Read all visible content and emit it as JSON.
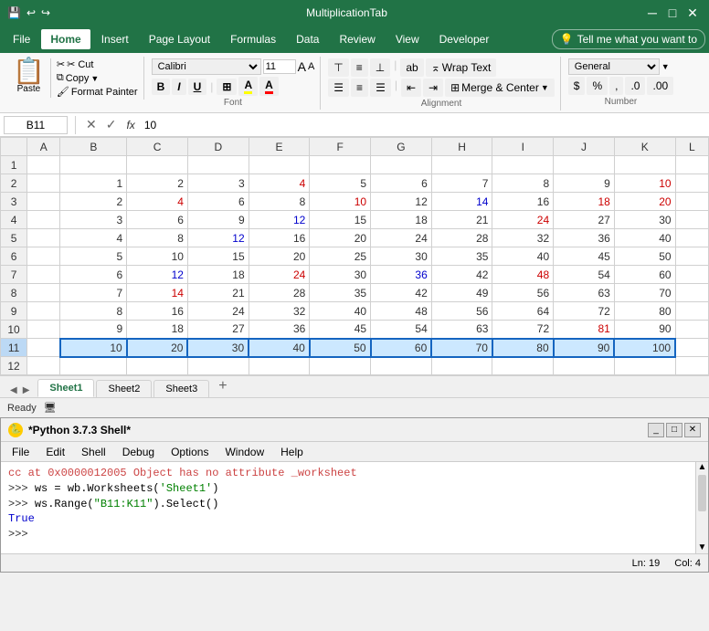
{
  "titleBar": {
    "title": "MultiplicationTab",
    "saveIcon": "💾",
    "undoIcon": "↩",
    "redoIcon": "↪"
  },
  "menuBar": {
    "items": [
      "File",
      "Home",
      "Insert",
      "Page Layout",
      "Formulas",
      "Data",
      "Review",
      "View",
      "Developer"
    ],
    "activeItem": "Home",
    "tellMe": "Tell me what you want to"
  },
  "ribbon": {
    "clipboard": {
      "paste": "Paste",
      "cut": "✂ Cut",
      "copy": "Copy",
      "formatPainter": "Format Painter"
    },
    "font": {
      "name": "Calibri",
      "size": "11",
      "bold": "B",
      "italic": "I",
      "underline": "U"
    },
    "alignment": {
      "wrapText": "Wrap Text",
      "mergeCenter": "Merge & Center"
    },
    "number": {
      "format": "General"
    }
  },
  "formulaBar": {
    "cellRef": "B11",
    "formula": "10"
  },
  "spreadsheet": {
    "colHeaders": [
      "",
      "A",
      "B",
      "C",
      "D",
      "E",
      "F",
      "G",
      "H",
      "I",
      "J",
      "K",
      "L"
    ],
    "rows": [
      {
        "id": 1,
        "cells": [
          "",
          "",
          "",
          "",
          "",
          "",
          "",
          "",
          "",
          "",
          "",
          ""
        ]
      },
      {
        "id": 2,
        "cells": [
          "",
          "1",
          "2",
          "3",
          "4",
          "5",
          "6",
          "7",
          "8",
          "9",
          "10"
        ]
      },
      {
        "id": 3,
        "cells": [
          "",
          "2",
          "4",
          "6",
          "8",
          "10",
          "12",
          "14",
          "16",
          "18",
          "20"
        ]
      },
      {
        "id": 4,
        "cells": [
          "",
          "3",
          "6",
          "9",
          "12",
          "15",
          "18",
          "21",
          "24",
          "27",
          "30"
        ]
      },
      {
        "id": 5,
        "cells": [
          "",
          "4",
          "8",
          "12",
          "16",
          "20",
          "24",
          "28",
          "32",
          "36",
          "40"
        ]
      },
      {
        "id": 6,
        "cells": [
          "",
          "5",
          "10",
          "15",
          "20",
          "25",
          "30",
          "35",
          "40",
          "45",
          "50"
        ]
      },
      {
        "id": 7,
        "cells": [
          "",
          "6",
          "12",
          "18",
          "24",
          "30",
          "36",
          "42",
          "48",
          "54",
          "60"
        ]
      },
      {
        "id": 8,
        "cells": [
          "",
          "7",
          "14",
          "21",
          "28",
          "35",
          "42",
          "49",
          "56",
          "63",
          "70"
        ]
      },
      {
        "id": 9,
        "cells": [
          "",
          "8",
          "16",
          "24",
          "32",
          "40",
          "48",
          "56",
          "64",
          "72",
          "80"
        ]
      },
      {
        "id": 10,
        "cells": [
          "",
          "9",
          "18",
          "27",
          "36",
          "45",
          "54",
          "63",
          "72",
          "81",
          "90"
        ]
      },
      {
        "id": 11,
        "cells": [
          "",
          "10",
          "20",
          "30",
          "40",
          "50",
          "60",
          "70",
          "80",
          "90",
          "100"
        ]
      }
    ],
    "selectedRange": "B11:K11"
  },
  "sheetTabs": {
    "sheets": [
      "Sheet1",
      "Sheet2",
      "Sheet3"
    ],
    "active": "Sheet1",
    "addLabel": "+"
  },
  "statusBar": {
    "status": "Ready",
    "cellMode": "🖥"
  },
  "pythonShell": {
    "title": "*Python 3.7.3 Shell*",
    "menu": [
      "File",
      "Edit",
      "Shell",
      "Debug",
      "Options",
      "Window",
      "Help"
    ],
    "lines": [
      {
        "type": "error",
        "text": "cc at 0x0000012005 Object has no attribute _worksheet"
      },
      {
        "type": "prompt",
        "text": ">>> ws = wb.Worksheets('Sheet1')"
      },
      {
        "type": "prompt",
        "text": ">>> ws.Range(\"B11:K11\").Select()"
      },
      {
        "type": "output",
        "text": "True"
      },
      {
        "type": "prompt",
        "text": ">>>"
      }
    ],
    "status": {
      "ln": "Ln: 19",
      "col": "Col: 4"
    }
  }
}
